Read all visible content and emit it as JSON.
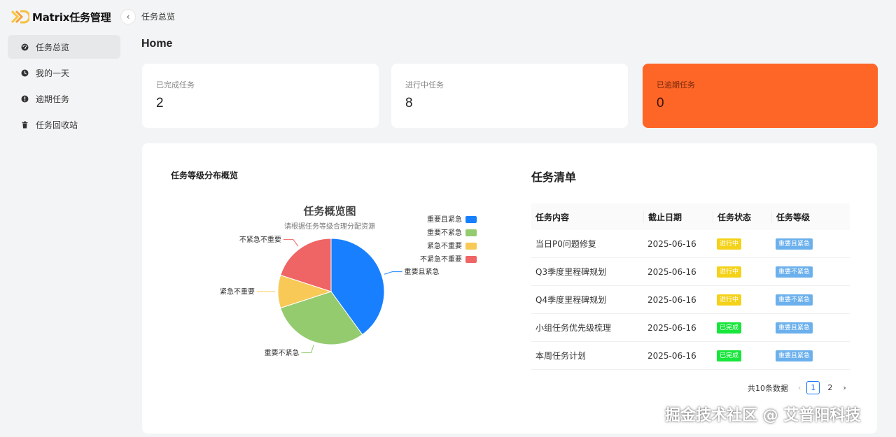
{
  "app": {
    "name": "Matrix任务管理"
  },
  "sidebar": {
    "items": [
      {
        "label": "任务总览",
        "icon": "dashboard-icon",
        "active": true
      },
      {
        "label": "我的一天",
        "icon": "clock-icon",
        "active": false
      },
      {
        "label": "逾期任务",
        "icon": "alert-icon",
        "active": false
      },
      {
        "label": "任务回收站",
        "icon": "trash-icon",
        "active": false
      }
    ]
  },
  "header": {
    "breadcrumb": "任务总览",
    "title": "Home"
  },
  "stats": [
    {
      "label": "已完成任务",
      "value": "2"
    },
    {
      "label": "进行中任务",
      "value": "8"
    },
    {
      "label": "已逾期任务",
      "value": "0"
    }
  ],
  "chart_section": {
    "heading": "任务等级分布概览"
  },
  "chart_data": {
    "type": "pie",
    "title": "任务概览图",
    "subtitle": "请根据任务等级合理分配资源",
    "legend_position": "top-right",
    "categories": [
      "重要且紧急",
      "重要不紧急",
      "紧急不重要",
      "不紧急不重要"
    ],
    "values": [
      4,
      3,
      1,
      2
    ],
    "colors": [
      "#1880ff",
      "#94cb6f",
      "#f8c956",
      "#ef6465"
    ]
  },
  "task_list": {
    "heading": "任务清单",
    "columns": [
      "任务内容",
      "截止日期",
      "任务状态",
      "任务等级"
    ],
    "rows": [
      {
        "content": "当日P0问题修复",
        "date": "2025-06-16",
        "status": "进行中",
        "level": "重要且紧急"
      },
      {
        "content": "Q3季度里程碑规划",
        "date": "2025-06-16",
        "status": "进行中",
        "level": "重要不紧急"
      },
      {
        "content": "Q4季度里程碑规划",
        "date": "2025-06-16",
        "status": "进行中",
        "level": "重要不紧急"
      },
      {
        "content": "小组任务优先级梳理",
        "date": "2025-06-16",
        "status": "已完成",
        "level": "重要且紧急"
      },
      {
        "content": "本周任务计划",
        "date": "2025-06-16",
        "status": "已完成",
        "level": "重要且紧急"
      }
    ],
    "status_colors": {
      "进行中": "#f5d21a",
      "已完成": "#17e63a"
    },
    "level_color": "#6bb0ec"
  },
  "pagination": {
    "total_text": "共10条数据",
    "pages": [
      "1",
      "2"
    ],
    "current": "1"
  },
  "watermark": "掘金技术社区 @ 艾普阳科技"
}
